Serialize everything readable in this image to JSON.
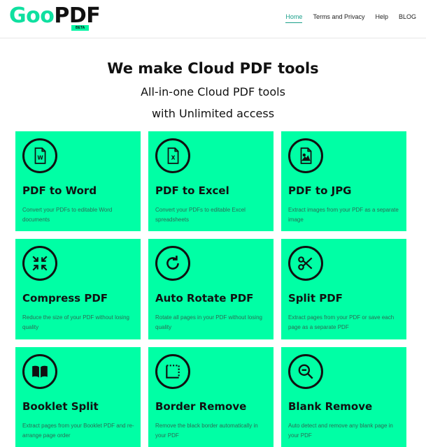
{
  "header": {
    "logo_goo": "Goo",
    "logo_pdf": "PDF",
    "beta": "BETA",
    "nav": [
      "Home",
      "Terms and Privacy",
      "Help",
      "BLOG"
    ]
  },
  "hero": {
    "title": "We make Cloud PDF tools",
    "subtitle_1": "All-in-one Cloud PDF tools",
    "subtitle_2": "with Unlimited access"
  },
  "tools": [
    {
      "title": "PDF to Word",
      "desc": "Convert your PDFs to editable Word documents",
      "icon": "word-file-icon"
    },
    {
      "title": "PDF to Excel",
      "desc": "Convert your PDFs to editable Excel spreadsheets",
      "icon": "excel-file-icon"
    },
    {
      "title": "PDF to JPG",
      "desc": "Extract images from your PDF as a separate image",
      "icon": "image-file-icon"
    },
    {
      "title": "Compress PDF",
      "desc": "Reduce the size of your PDF without losing quality",
      "icon": "compress-arrows-icon"
    },
    {
      "title": "Auto Rotate PDF",
      "desc": "Rotate all pages in your PDF without losing quality",
      "icon": "rotate-icon"
    },
    {
      "title": "Split PDF",
      "desc": "Extract pages from your PDF or save each page as a separate PDF",
      "icon": "scissors-icon"
    },
    {
      "title": "Booklet Split",
      "desc": "Extract pages from your Booklet PDF and re-arrange page order",
      "icon": "open-book-icon"
    },
    {
      "title": "Border Remove",
      "desc": "Remove the black border automatically in your PDF",
      "icon": "border-frame-icon"
    },
    {
      "title": "Blank Remove",
      "desc": "Auto detect and remove any blank page in your PDF",
      "icon": "magnifier-minus-icon"
    }
  ],
  "colors": {
    "accent": "#00ffa5",
    "logo_green": "#0fe0a0",
    "nav_active": "#1a9f8a"
  }
}
